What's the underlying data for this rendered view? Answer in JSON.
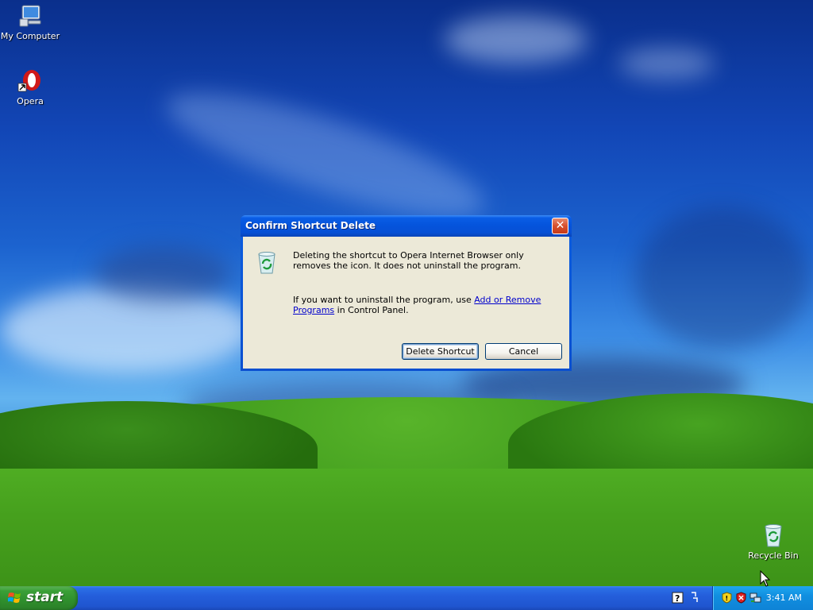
{
  "desktop": {
    "icons": [
      {
        "label": "My Computer",
        "icon": "my-computer-icon"
      },
      {
        "label": "Opera",
        "icon": "opera-icon"
      },
      {
        "label": "Recycle Bin",
        "icon": "recycle-bin-icon"
      }
    ]
  },
  "dialog": {
    "title": "Confirm Shortcut Delete",
    "close_label": "✕",
    "message_1": "Deleting the shortcut to Opera Internet Browser only removes the icon. It does not uninstall the program.",
    "message_2_prefix": "If you want to uninstall the program, use ",
    "message_2_link": "Add or Remove Programs",
    "message_2_suffix": " in Control Panel.",
    "delete_button": "Delete Shortcut",
    "cancel_button": "Cancel",
    "icon": "recycle-bin-icon"
  },
  "taskbar": {
    "start_label": "start",
    "clock": "3:41 AM",
    "tray_icons": [
      "help-icon",
      "network-icon",
      "security-shield-icon",
      "alert-shield-icon",
      "network-connection-icon"
    ]
  },
  "colors": {
    "title_bar": "#0554dc",
    "dialog_body": "#ece9d8",
    "start_button": "#3a9f37",
    "taskbar": "#245edb",
    "tray": "#118fe0",
    "link": "#0000cc"
  }
}
